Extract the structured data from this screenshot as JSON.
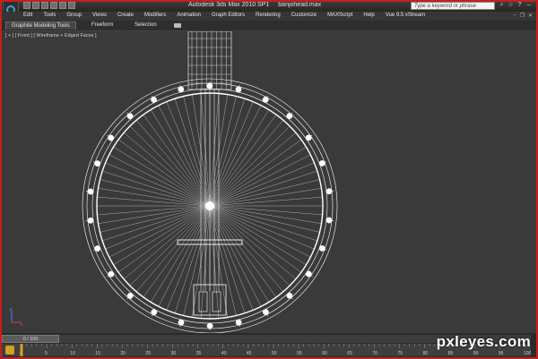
{
  "window": {
    "title": "Autodesk 3ds Max  2010 SP1",
    "filename": "banjohead.max",
    "search_placeholder": "Type a keyword or phrase"
  },
  "menu": {
    "items": [
      "Edit",
      "Tools",
      "Group",
      "Views",
      "Create",
      "Modifiers",
      "Animation",
      "Graph Editors",
      "Rendering",
      "Customize",
      "MAXScript",
      "Help",
      "Vue 9.5 xStream"
    ]
  },
  "ribbon": {
    "tabs": [
      "Graphite Modeling Tools",
      "Freeform",
      "Selection"
    ]
  },
  "viewport": {
    "label": "[ + ] [ Front ] [ Wireframe + Edged Faces ]"
  },
  "timeline": {
    "slider_label": "0 / 100",
    "frame_current": 0,
    "frame_total": 100,
    "ticks": [
      "0",
      "5",
      "10",
      "15",
      "20",
      "25",
      "30",
      "35",
      "40",
      "45",
      "50",
      "55",
      "60",
      "65",
      "70",
      "75",
      "80",
      "85",
      "90",
      "95",
      "100"
    ]
  },
  "watermark": "pxleyes.com",
  "colors": {
    "accent_red": "#c81e1e",
    "wireframe": "#ffffff",
    "viewport_bg": "#3a3a3a"
  }
}
